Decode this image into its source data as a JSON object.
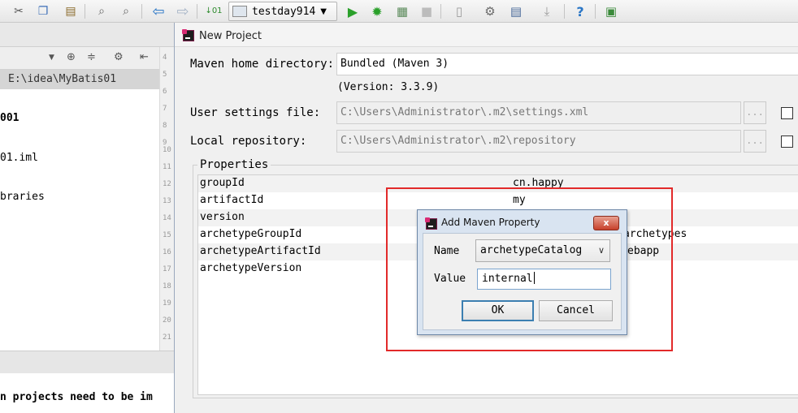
{
  "toolbar": {
    "icons": [
      "cut-icon",
      "copy-icon",
      "paste-icon",
      "find-icon",
      "replace-icon",
      "back-icon",
      "forward-icon",
      "build-icon",
      "run-icon",
      "debug-icon",
      "coverage-icon",
      "stop-icon",
      "sdk-icon",
      "settings-icon",
      "structure-icon",
      "vcs-icon",
      "help-icon",
      "plugin-icon"
    ],
    "run_config": "testday914"
  },
  "left_panel": {
    "path": "E:\\idea\\MyBatis01",
    "tree": [
      {
        "text": "001",
        "bold": true
      },
      {
        "text": "01.iml",
        "bold": false
      },
      {
        "text": "braries",
        "bold": false
      }
    ],
    "line_numbers": [
      "4",
      "5",
      "6",
      "7",
      "8",
      "9",
      "10",
      "11",
      "12",
      "13",
      "14",
      "15",
      "16",
      "17",
      "18",
      "19",
      "20",
      "21"
    ]
  },
  "bottom_panel": {
    "message": "n projects need to be im"
  },
  "new_project_dialog": {
    "title": "New Project",
    "maven_home_label": "Maven home directory:",
    "maven_home_value": "Bundled (Maven 3)",
    "version_text": "(Version: 3.3.9)",
    "user_settings_label": "User settings file:",
    "user_settings_value": "C:\\Users\\Administrator\\.m2\\settings.xml",
    "local_repo_label": "Local repository:",
    "local_repo_value": "C:\\Users\\Administrator\\.m2\\repository",
    "browse_label": "...",
    "properties_legend": "Properties",
    "properties": [
      {
        "key": "groupId",
        "value": "cn.happy"
      },
      {
        "key": "artifactId",
        "value": "my"
      },
      {
        "key": "version",
        "value": ""
      },
      {
        "key": "archetypeGroupId",
        "value": "archetypes"
      },
      {
        "key": "archetypeArtifactId",
        "value": "ebapp"
      },
      {
        "key": "archetypeVersion",
        "value": ""
      }
    ]
  },
  "add_property_dialog": {
    "title": "Add Maven Property",
    "close_label": "x",
    "name_label": "Name",
    "name_value": "archetypeCatalog",
    "value_label": "Value",
    "value_value": "internal",
    "ok_label": "OK",
    "cancel_label": "Cancel"
  },
  "colors": {
    "highlight": "#e22a2a",
    "dialog_bg": "#f0f0f0",
    "accent": "#3c7fb1"
  }
}
